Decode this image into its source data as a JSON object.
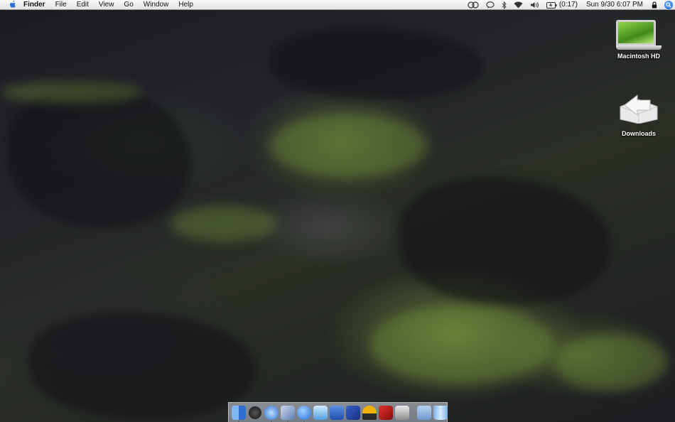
{
  "menubar": {
    "app_name": "Finder",
    "menus": [
      "File",
      "Edit",
      "View",
      "Go",
      "Window",
      "Help"
    ],
    "battery_time": "(0:17)",
    "clock": "Sun 9/30  6:07 PM"
  },
  "desktop_icons": [
    {
      "label": "Macintosh HD",
      "icon": "laptop-icon"
    },
    {
      "label": "Downloads",
      "icon": "downloads-folder-icon"
    }
  ],
  "dock": {
    "apps": [
      {
        "name": "finder-icon",
        "color": "#3f7fd6",
        "running": true
      },
      {
        "name": "dashboard-icon",
        "color": "#2a2a2a",
        "running": false
      },
      {
        "name": "safari-icon",
        "color": "#4a86d8",
        "running": true
      },
      {
        "name": "mail-icon",
        "color": "#6a8fc4",
        "running": true
      },
      {
        "name": "ichat-icon",
        "color": "#3a7bd5",
        "running": true
      },
      {
        "name": "itunes-icon",
        "color": "#4fa0e0",
        "running": false
      },
      {
        "name": "word-icon",
        "color": "#2b66c7",
        "running": false
      },
      {
        "name": "xcode-icon",
        "color": "#2c50b8",
        "running": false
      },
      {
        "name": "disk-utility-icon",
        "color": "#e0a000",
        "running": false
      },
      {
        "name": "flashcard-icon",
        "color": "#c8201e",
        "running": false
      },
      {
        "name": "system-preferences-icon",
        "color": "#9a9a9a",
        "running": false
      }
    ],
    "others": [
      {
        "name": "applications-folder-icon",
        "color": "#7ea7d8"
      },
      {
        "name": "trash-icon",
        "color": "#9fc3e8"
      }
    ]
  }
}
